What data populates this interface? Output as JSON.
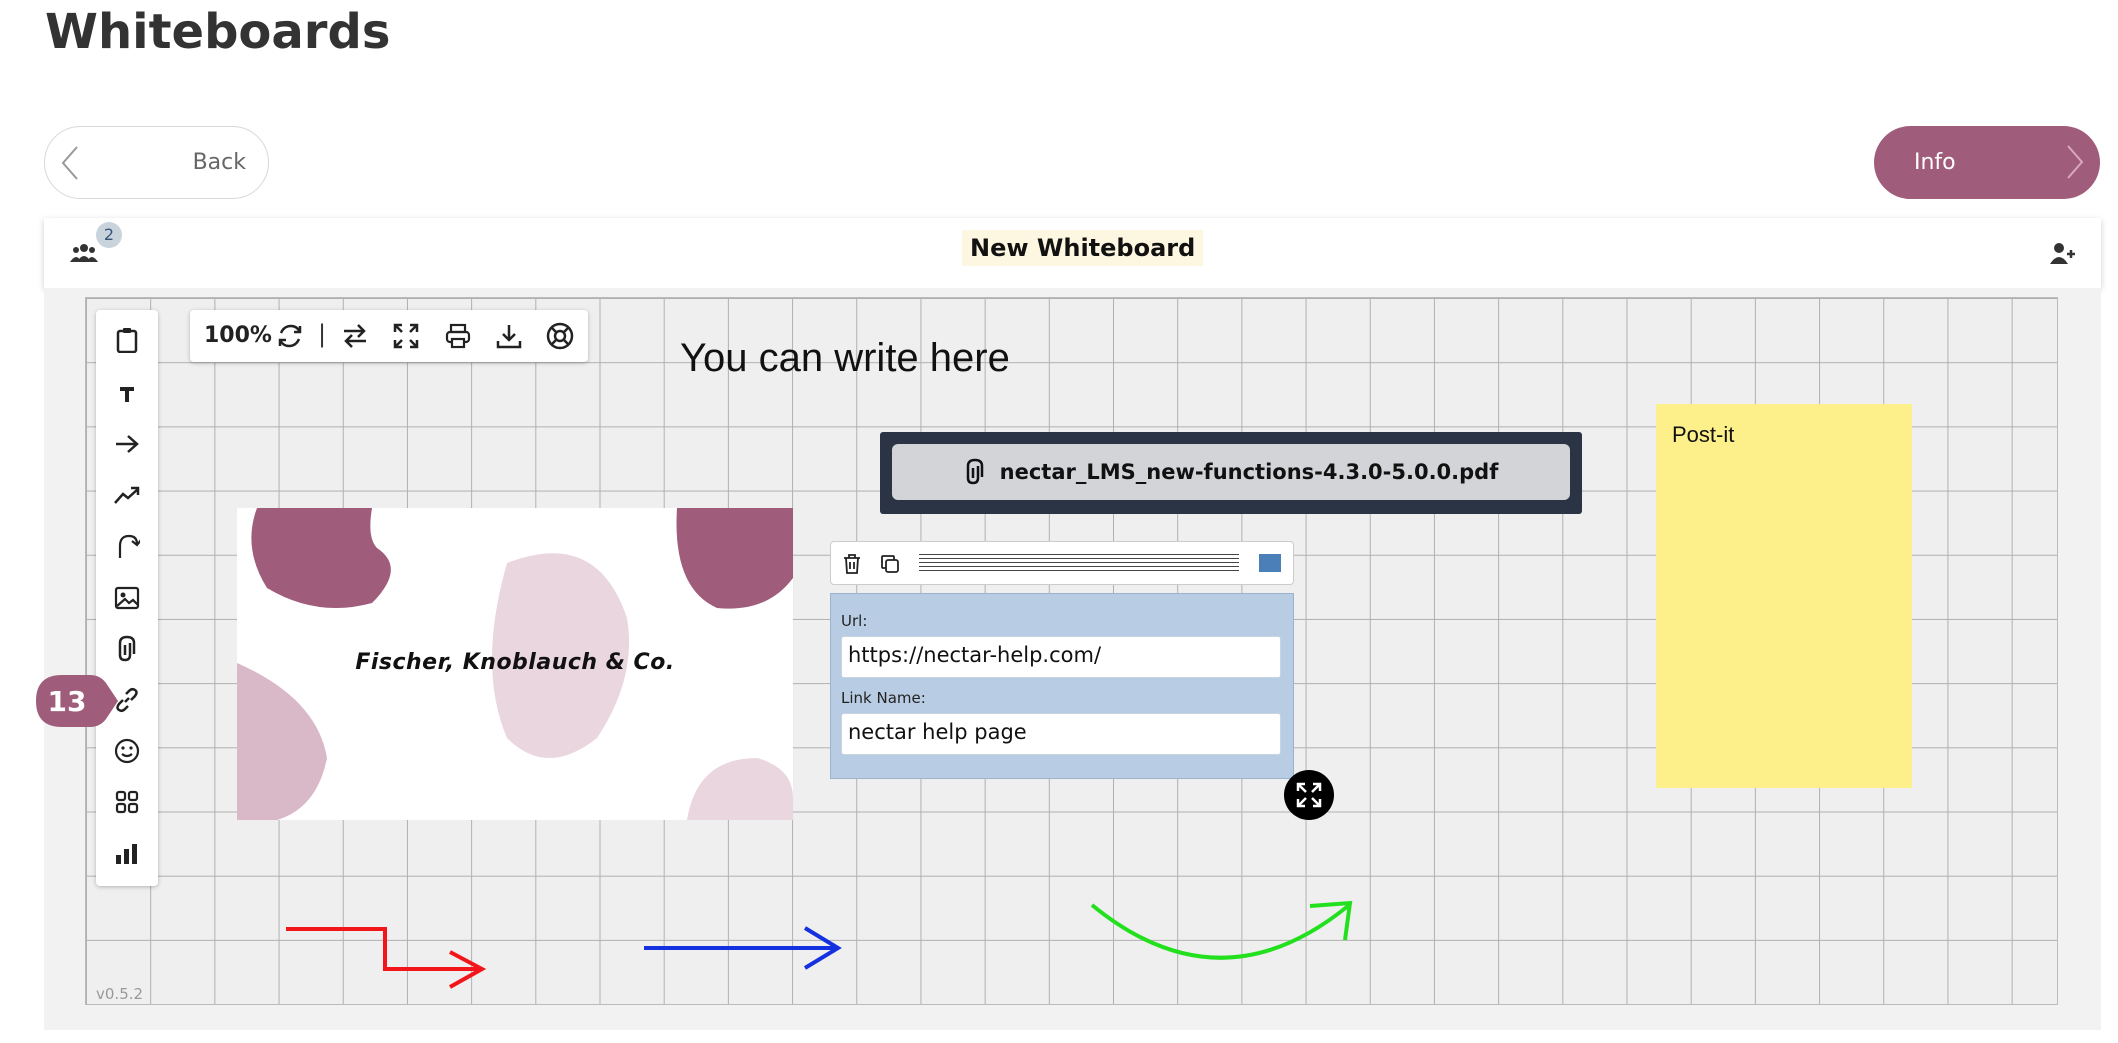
{
  "page": {
    "title": "Whiteboards"
  },
  "nav": {
    "back_label": "Back",
    "info_label": "Info"
  },
  "header": {
    "user_count": "2",
    "whiteboard_name": "New Whiteboard"
  },
  "toolbar": {
    "zoom": "100%",
    "separator": "|",
    "tools": [
      "clipboard-icon",
      "text-icon",
      "arrow-icon",
      "trend-arrow-icon",
      "curved-arrow-icon",
      "image-icon",
      "attachment-icon",
      "link-icon",
      "emoji-icon",
      "grid-icon",
      "chart-icon"
    ],
    "top_tools": [
      "refresh-icon",
      "swap-icon",
      "fullscreen-icon",
      "print-icon",
      "download-icon",
      "help-icon"
    ]
  },
  "step_badge": "13",
  "canvas": {
    "text": "You can write here",
    "file_name": "nectar_LMS_new-functions-4.3.0-5.0.0.pdf",
    "postit_text": "Post-it",
    "company_name": "Fischer, Knoblauch & Co.",
    "version": "v0.5.2",
    "link_form": {
      "url_label": "Url:",
      "url_value": "https://nectar-help.com/",
      "name_label": "Link Name:",
      "name_value": "nectar help page"
    }
  },
  "colors": {
    "accent": "#a05c7b",
    "postit": "#fdef8a",
    "link_form": "#b8cde3",
    "file_bg": "#2a3444",
    "arrow_red": "#f2151a",
    "arrow_blue": "#1431e0",
    "arrow_green": "#22e01e"
  }
}
